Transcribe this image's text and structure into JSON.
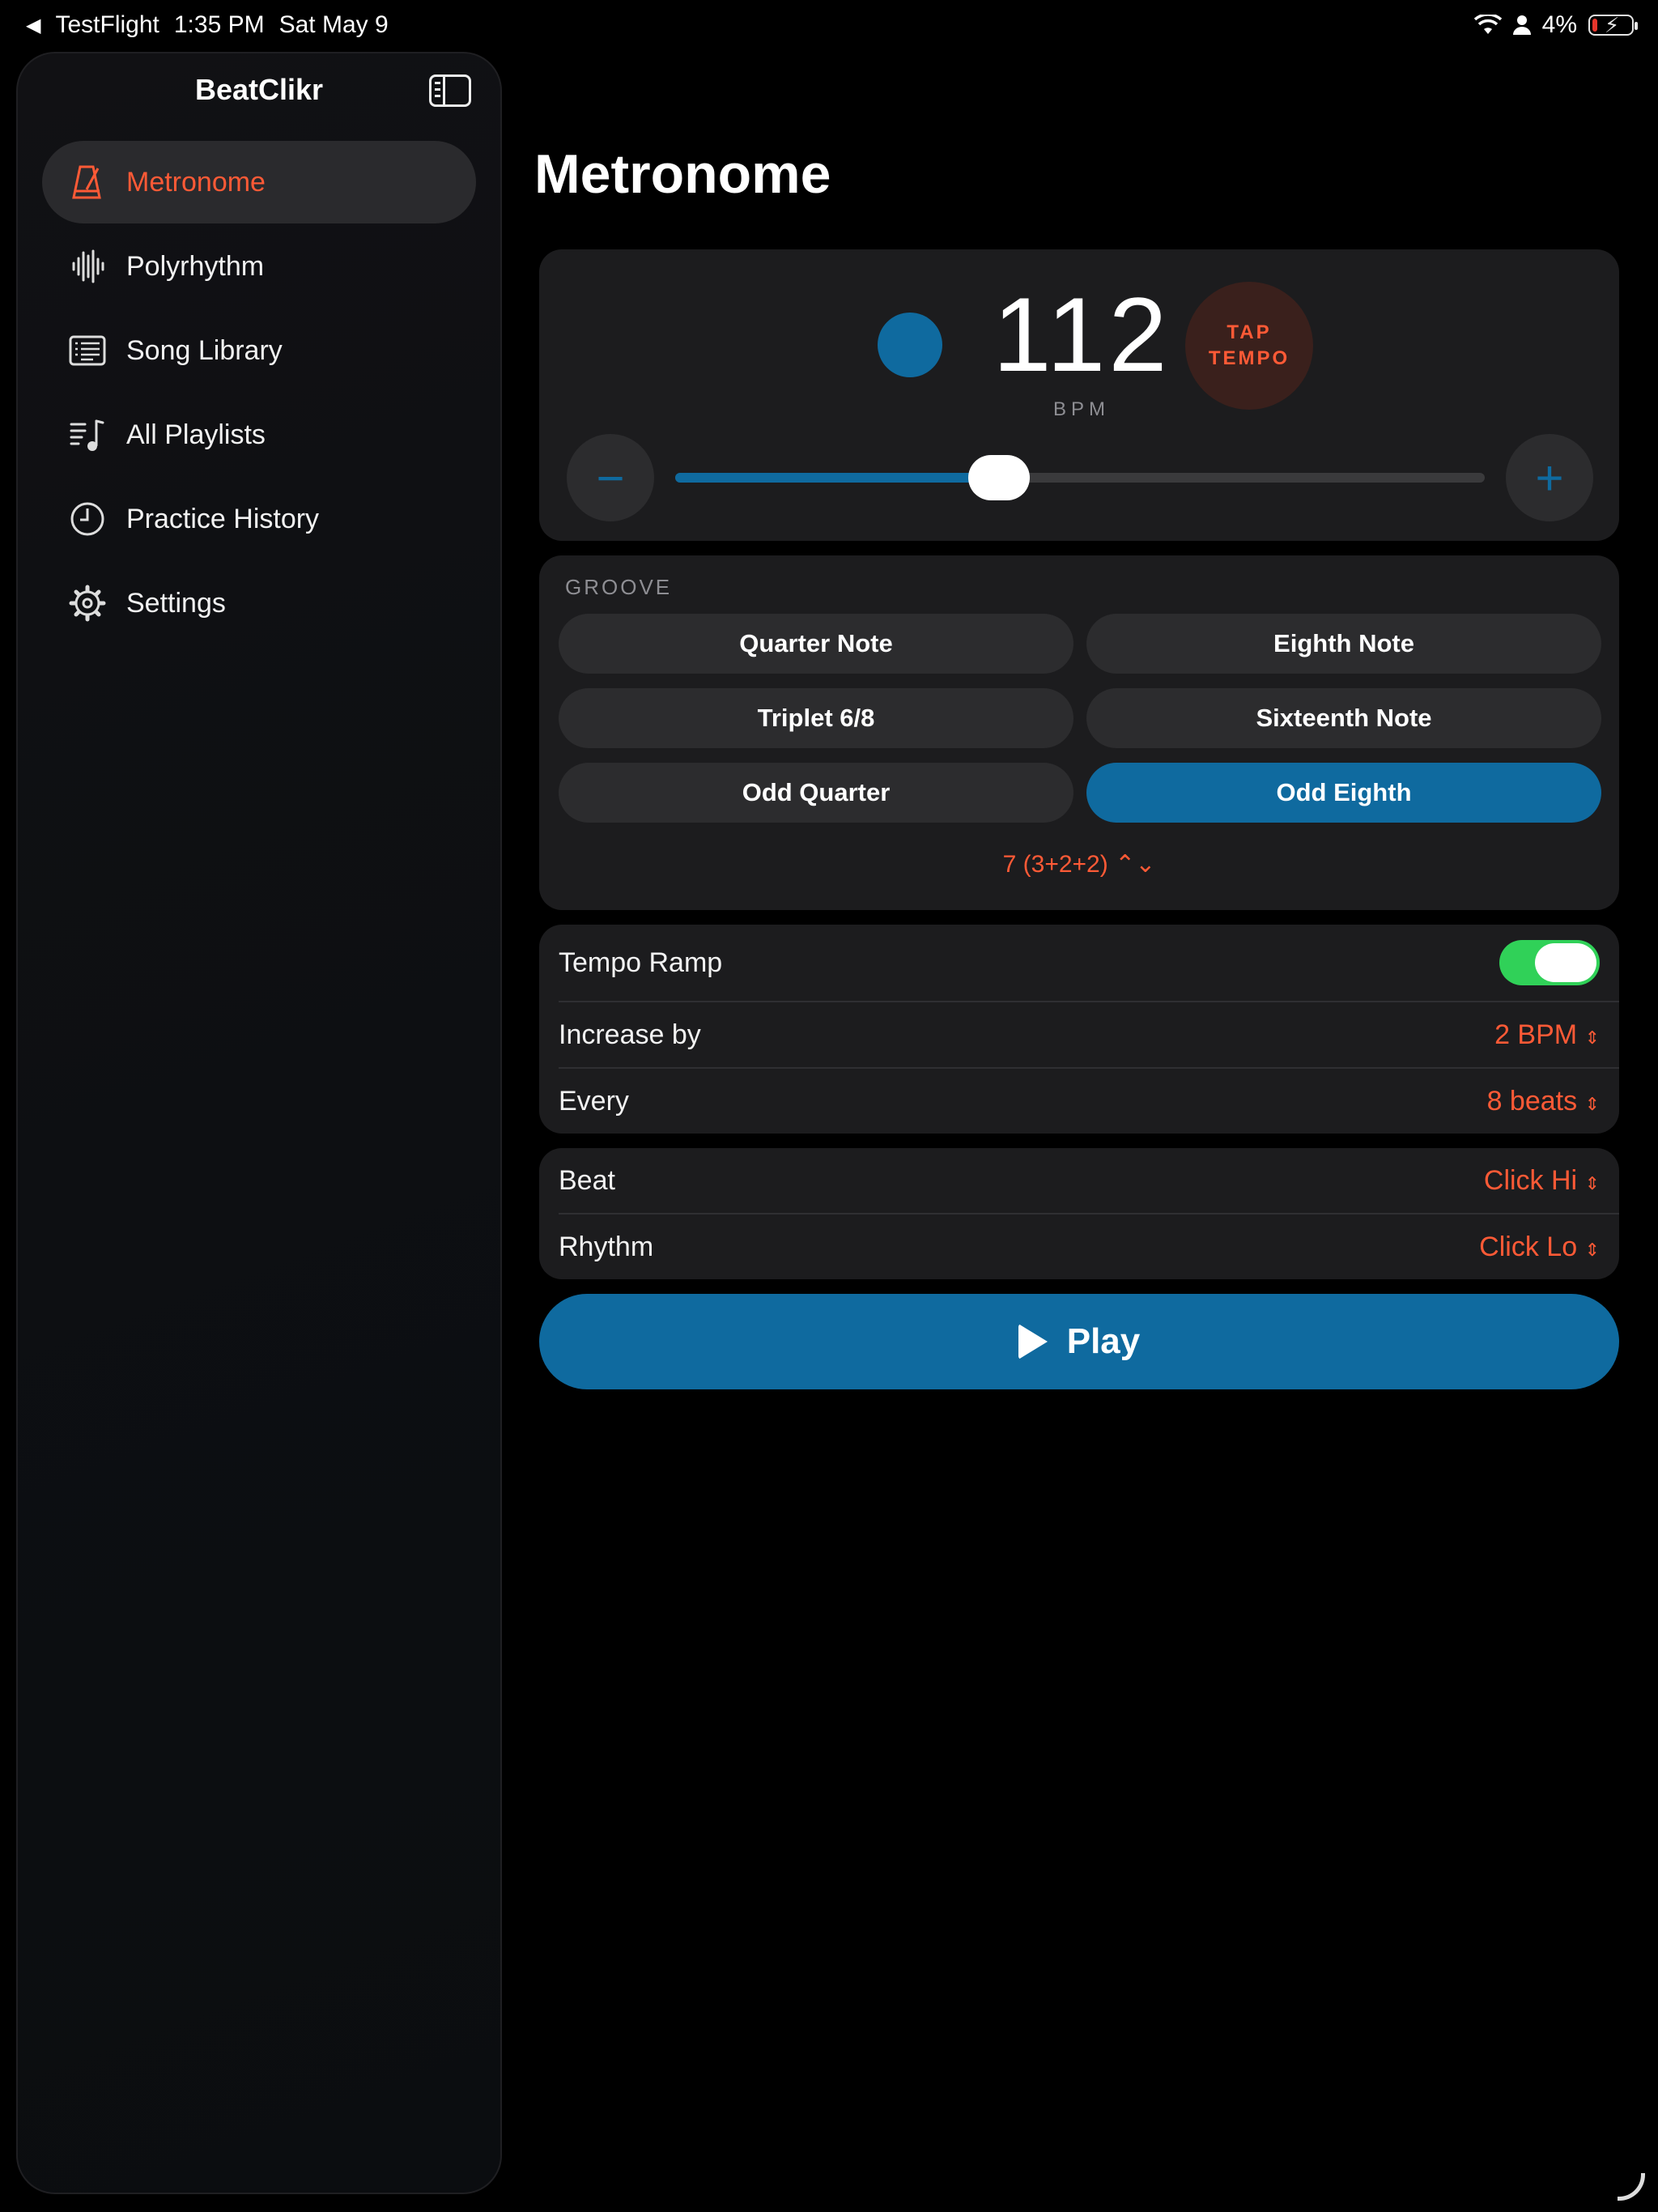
{
  "status_bar": {
    "back_app": "TestFlight",
    "time": "1:35 PM",
    "date": "Sat May 9",
    "battery": "4%"
  },
  "sidebar": {
    "app_title": "BeatClikr",
    "items": [
      {
        "label": "Metronome",
        "icon": "metronome-icon",
        "active": true
      },
      {
        "label": "Polyrhythm",
        "icon": "waveform-icon",
        "active": false
      },
      {
        "label": "Song Library",
        "icon": "list-card-icon",
        "active": false
      },
      {
        "label": "All Playlists",
        "icon": "playlist-icon",
        "active": false
      },
      {
        "label": "Practice History",
        "icon": "clock-icon",
        "active": false
      },
      {
        "label": "Settings",
        "icon": "gear-icon",
        "active": false
      }
    ]
  },
  "main": {
    "title": "Metronome",
    "tempo": {
      "bpm": "112",
      "bpm_unit": "BPM",
      "tap_line1": "TAP",
      "tap_line2": "TEMPO",
      "minus": "−",
      "plus": "+",
      "slider_fraction": 0.4
    },
    "groove": {
      "label": "GROOVE",
      "options": [
        "Quarter Note",
        "Eighth Note",
        "Triplet 6/8",
        "Sixteenth Note",
        "Odd Quarter",
        "Odd Eighth"
      ],
      "selected": "Odd Eighth",
      "meter": "7 (3+2+2)"
    },
    "ramp": {
      "label": "Tempo Ramp",
      "enabled": true,
      "increase_label": "Increase by",
      "increase_value": "2 BPM",
      "every_label": "Every",
      "every_value": "8 beats"
    },
    "sounds": {
      "beat_label": "Beat",
      "beat_value": "Click Hi",
      "rhythm_label": "Rhythm",
      "rhythm_value": "Click Lo"
    },
    "play_label": "Play"
  },
  "colors": {
    "accent": "#ff5a36",
    "primary_blue": "#0f6a9f",
    "toggle_green": "#30d158",
    "card_bg": "#1c1c1e"
  }
}
